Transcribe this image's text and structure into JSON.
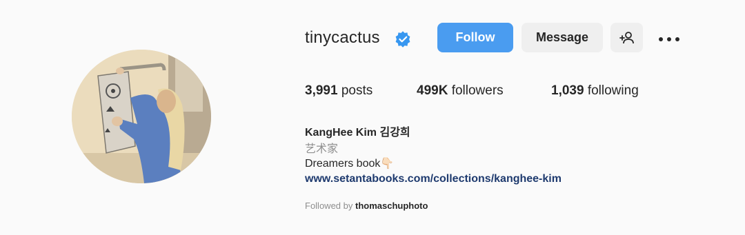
{
  "profile": {
    "username": "tinycactus",
    "verified_icon": "verified-badge-icon",
    "follow_label": "Follow",
    "message_label": "Message",
    "add_person_icon": "add-person-icon",
    "more_icon": "more-options-icon"
  },
  "stats": {
    "posts_count": "3,991",
    "posts_label": "posts",
    "followers_count": "499K",
    "followers_label": "followers",
    "following_count": "1,039",
    "following_label": "following"
  },
  "bio": {
    "full_name": "KangHee Kim 김강희",
    "category": "艺术家",
    "text": "Dreamers book",
    "emoji": "👇🏻",
    "link": "www.setantabooks.com/collections/kanghee-kim",
    "followed_by_prefix": "Followed by",
    "followed_by_user": "thomaschuphoto"
  },
  "colors": {
    "accent": "#4a9cf0",
    "link": "#1e3a6e",
    "muted": "#8e8e8e",
    "button_bg": "#efefef"
  }
}
